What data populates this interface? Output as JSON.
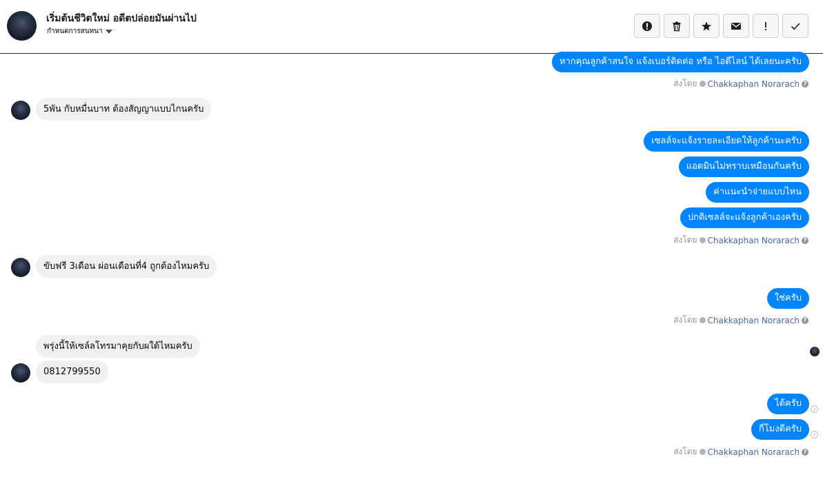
{
  "header": {
    "title": "เริ่มต้นชีวิตใหม่ อดีตปล่อยมันผ่านไป",
    "subtitle": "กำหนดการสนทนา",
    "toolbar": [
      {
        "name": "spam-button",
        "icon": "alert-circle-icon"
      },
      {
        "name": "delete-button",
        "icon": "trash-icon"
      },
      {
        "name": "star-button",
        "icon": "star-icon"
      },
      {
        "name": "mark-unread-button",
        "icon": "envelope-icon"
      },
      {
        "name": "important-button",
        "icon": "exclamation-icon"
      },
      {
        "name": "done-button",
        "icon": "check-icon"
      }
    ]
  },
  "sent_by": {
    "prefix": "ส่งโดย",
    "name": "Chakkaphan Norarach"
  },
  "messages": {
    "m1": "หากคุณลูกค้าสนใจ แจ้งเบอร์ติดต่อ หรือ ไอดีไลน์ ได้เลยนะครับ",
    "m2": "5พัน กับหมื่นบาท ต้องสัญญาแบบไกนครับ",
    "m3": "เซลล์จะแจ้งรายละเอียดให้ลูกค้านะครับ",
    "m4": "แอดมินไม่ทราบเหมือนกันครับ",
    "m5": "ค่าแนะนำจ่ายแบบไหน",
    "m6": "ปกติเซลล์จะแจ้งลูกค้าเองครับ",
    "m7": "ขับฟรี 3เดือน ผ่อนเดือนที่4 ถูกต้องไหมครับ",
    "m8": "ใช่ครับ",
    "m9": "พรุ่งนี้ให้เซล์ลโทรมาคุยกับผใด้ไหมครับ",
    "m10": "0812799550",
    "m11": "ได้ครับ",
    "m12": "กี่โมงดีครับ"
  },
  "colors": {
    "outgoing_bubble": "#0084ff",
    "incoming_bubble": "#f1f0f0",
    "sender_name": "#4b67a1"
  }
}
